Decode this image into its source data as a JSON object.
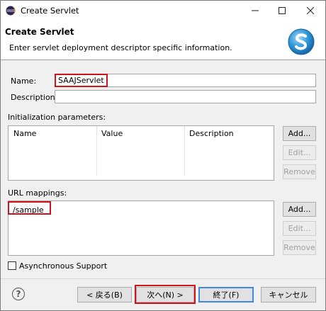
{
  "window": {
    "title": "Create Servlet"
  },
  "banner": {
    "title": "Create Servlet",
    "description": "Enter servlet deployment descriptor specific information."
  },
  "form": {
    "name_label": "Name:",
    "name_value": "SAAJServlet",
    "description_label": "Description:",
    "description_value": "",
    "init_params_label": "Initialization parameters:",
    "init_params_columns": [
      "Name",
      "Value",
      "Description"
    ],
    "url_mappings_label": "URL mappings:",
    "url_mappings": [
      "/sample"
    ],
    "async_label": "Asynchronous Support"
  },
  "side_buttons": {
    "add": "Add...",
    "edit": "Edit...",
    "remove": "Remove"
  },
  "footer": {
    "back": "< 戻る(B)",
    "next": "次へ(N) >",
    "finish": "終了(F)",
    "cancel": "キャンセル"
  },
  "colors": {
    "highlight_box": "#d0121b",
    "default_button_border": "#3b8be0"
  }
}
